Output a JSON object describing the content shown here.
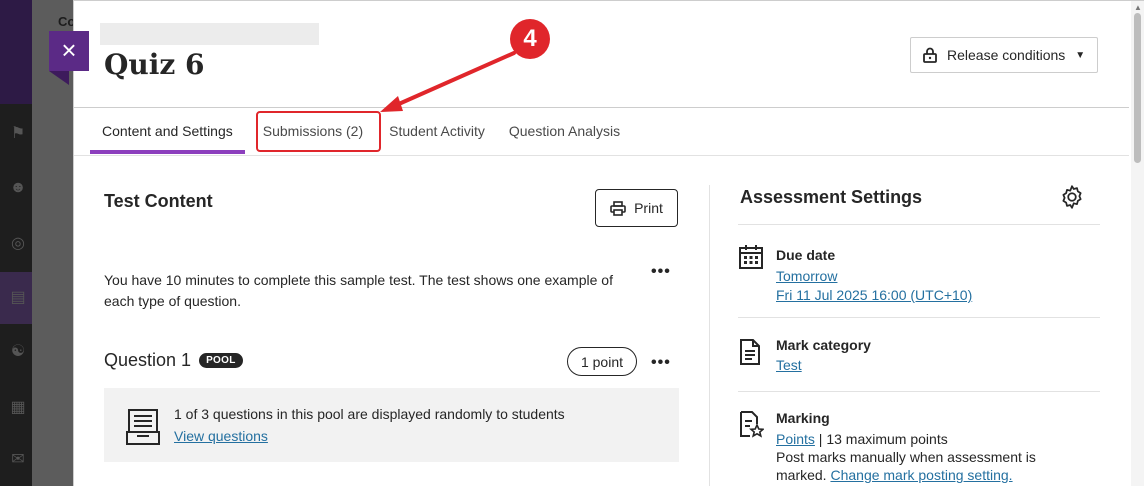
{
  "background": {
    "panel_label": "Co"
  },
  "header": {
    "title": "Quiz 6",
    "release_conditions_label": "Release conditions"
  },
  "tabs": [
    {
      "label": "Content and Settings",
      "active": true
    },
    {
      "label": "Submissions (2)",
      "active": false
    },
    {
      "label": "Student Activity",
      "active": false
    },
    {
      "label": "Question Analysis",
      "active": false
    }
  ],
  "annotation": {
    "step_number": "4"
  },
  "content": {
    "section_title": "Test Content",
    "print_label": "Print",
    "description": "You have 10 minutes to complete this sample test. The test shows one example of each type of question.",
    "question": {
      "title": "Question 1",
      "badge": "POOL",
      "points": "1 point",
      "pool_text": "1 of 3 questions in this pool are displayed randomly to students",
      "pool_link": "View questions"
    }
  },
  "settings": {
    "title": "Assessment Settings",
    "due_date": {
      "label": "Due date",
      "relative": "Tomorrow",
      "absolute": "Fri 11 Jul 2025 16:00 (UTC+10)"
    },
    "mark_category": {
      "label": "Mark category",
      "value": "Test"
    },
    "marking": {
      "label": "Marking",
      "points_link": "Points",
      "points_text": " | 13 maximum points",
      "post_text_line1": "Post marks manually when assessment is",
      "post_text_line2": "marked.",
      "change_link": "Change mark posting setting."
    }
  },
  "colors": {
    "accent": "#8c3fbd",
    "close_button": "#5b2a86",
    "link": "#2470a0",
    "annotation": "#e0262b"
  }
}
